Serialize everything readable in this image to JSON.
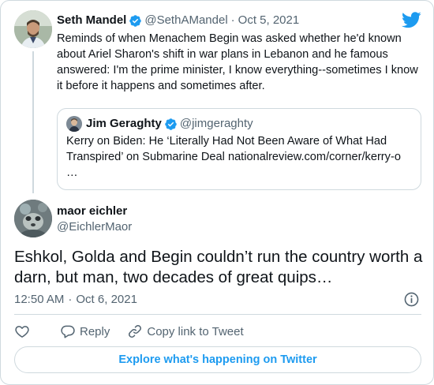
{
  "parent": {
    "name": "Seth Mandel",
    "handle": "@SethAMandel",
    "separator": "·",
    "date": "Oct 5, 2021",
    "text": "Reminds of when Menachem Begin was asked whether he'd known about Ariel Sharon's shift in war plans in Lebanon and he famous answered: I'm the prime minister, I know everything--sometimes I know it before it happens and sometimes after."
  },
  "quote": {
    "name": "Jim Geraghty",
    "handle": "@jimgeraghty",
    "text_line1": "Kerry on Biden: He ‘Literally Had Not Been Aware of What Had",
    "text_line2": "Transpired’ on Submarine Deal nationalreview.com/corner/kerry-o",
    "text_line3": "…"
  },
  "tweet": {
    "name": "maor eichler",
    "handle": "@EichlerMaor",
    "text": "Eshkol, Golda and Begin couldn’t run the country worth a darn, but man, two decades of great quips…",
    "time": "12:50 AM",
    "separator": "·",
    "date": "Oct 6, 2021"
  },
  "actions": {
    "reply_label": "Reply",
    "copy_label": "Copy link to Tweet"
  },
  "explore_label": "Explore what's happening on Twitter",
  "icons": {
    "brand": "twitter-bird-icon",
    "verified": "verified-badge-icon",
    "like": "heart-icon",
    "reply": "reply-bubble-icon",
    "copy": "link-icon",
    "info": "info-icon"
  },
  "colors": {
    "accent": "#1d9bf0",
    "text": "#0f1419",
    "secondary": "#536471",
    "border": "#cfd9de"
  }
}
